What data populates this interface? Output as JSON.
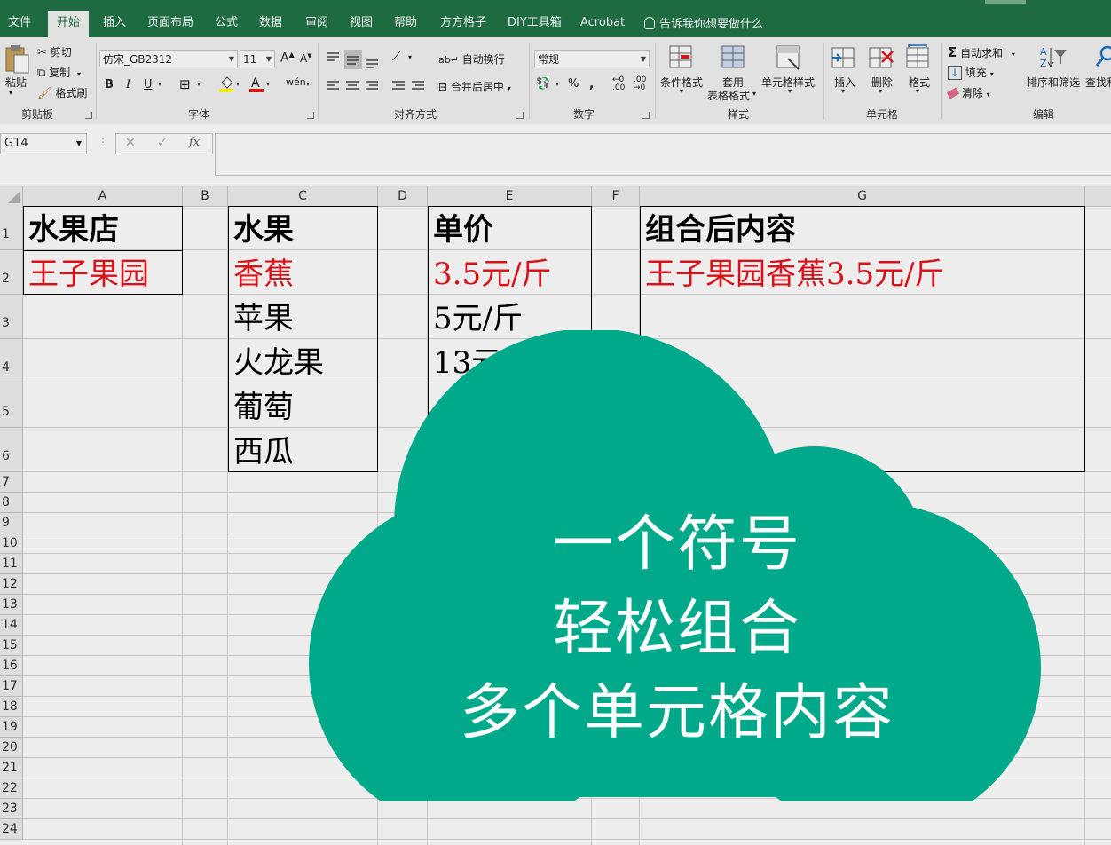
{
  "ribbon_tabs": [
    "文件",
    "开始",
    "插入",
    "页面布局",
    "公式",
    "数据",
    "审阅",
    "视图",
    "帮助",
    "方方格子",
    "DIY工具箱",
    "Acrobat"
  ],
  "active_tab": "开始",
  "tell_me": "告诉我你想要做什么",
  "clipboard": {
    "paste": "粘贴",
    "cut": "剪切",
    "copy": "复制",
    "format_painter": "格式刷",
    "label": "剪贴板"
  },
  "font": {
    "name": "仿宋_GB2312",
    "size": "11",
    "label": "字体"
  },
  "alignment": {
    "wrap": "自动换行",
    "merge": "合并后居中",
    "label": "对齐方式"
  },
  "number": {
    "format": "常规",
    "label": "数字"
  },
  "styles": {
    "conditional": "条件格式",
    "table_format_1": "套用",
    "table_format_2": "表格格式",
    "cell_styles": "单元格样式",
    "label": "样式"
  },
  "cells": {
    "insert": "插入",
    "delete": "删除",
    "format": "格式",
    "label": "单元格"
  },
  "editing": {
    "autosum": "自动求和",
    "fill": "填充",
    "clear": "清除",
    "sort_filter": "排序和筛选",
    "find": "查找和",
    "label": "编辑"
  },
  "name_box": "G14",
  "columns": [
    "A",
    "B",
    "C",
    "D",
    "E",
    "F",
    "G"
  ],
  "rows": [
    "1",
    "2",
    "3",
    "4",
    "5",
    "6",
    "7",
    "8",
    "9",
    "10",
    "11",
    "12",
    "13",
    "14",
    "15",
    "16",
    "17",
    "18",
    "19",
    "20",
    "21",
    "22",
    "23",
    "24"
  ],
  "sheet": {
    "A1": "水果店",
    "A2": "王子果园",
    "C1": "水果",
    "C2": "香蕉",
    "C3": "苹果",
    "C4": "火龙果",
    "C5": "葡萄",
    "C6": "西瓜",
    "E1": "单价",
    "E2": "3.5元/斤",
    "E3": "5元/斤",
    "E4": "13元",
    "G1": "组合后内容",
    "G2": "王子果园香蕉3.5元/斤"
  },
  "callout": {
    "line1": "一个符号",
    "line2": "轻松组合",
    "line3": "多个单元格内容",
    "color": "#00a98a"
  },
  "colors": {
    "excel_green": "#217346",
    "highlight_red": "#e8141b"
  }
}
